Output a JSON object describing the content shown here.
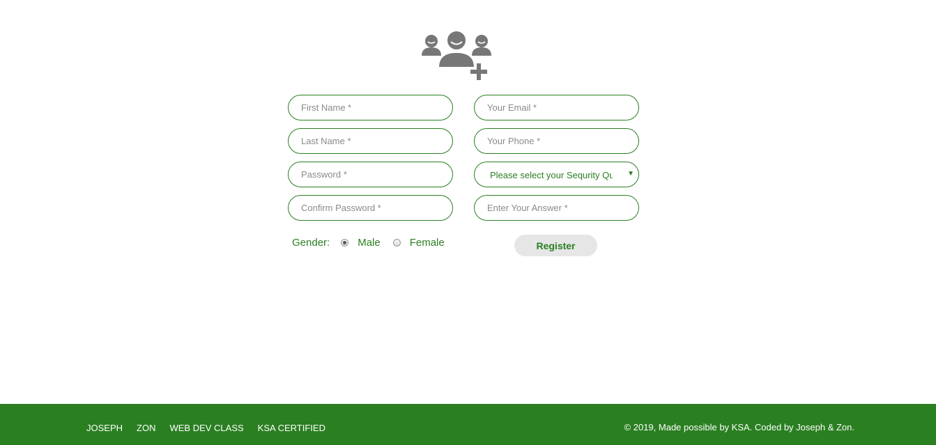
{
  "form": {
    "icon": "add-users-icon",
    "fields": {
      "first_name": {
        "placeholder": "First Name *",
        "value": ""
      },
      "last_name": {
        "placeholder": "Last Name *",
        "value": ""
      },
      "password": {
        "placeholder": "Password *",
        "value": ""
      },
      "confirm_password": {
        "placeholder": "Confirm Password *",
        "value": ""
      },
      "email": {
        "placeholder": "Your Email *",
        "value": ""
      },
      "phone": {
        "placeholder": "Your Phone *",
        "value": ""
      },
      "security_question": {
        "selected": "Please select your Sequrity Question"
      },
      "answer": {
        "placeholder": "Enter Your Answer *",
        "value": ""
      }
    },
    "gender": {
      "label": "Gender:",
      "options": [
        {
          "label": "Male",
          "checked": true
        },
        {
          "label": "Female",
          "checked": false
        }
      ]
    },
    "register_label": "Register"
  },
  "footer": {
    "links": [
      "JOSEPH",
      "ZON",
      "WEB DEV CLASS",
      "KSA CERTIFIED"
    ],
    "copyright": "© 2019, Made possible by KSA. Coded by Joseph & Zon."
  },
  "colors": {
    "accent": "#2a7f21",
    "icon": "#777777",
    "button_bg": "#e6e6e6"
  }
}
